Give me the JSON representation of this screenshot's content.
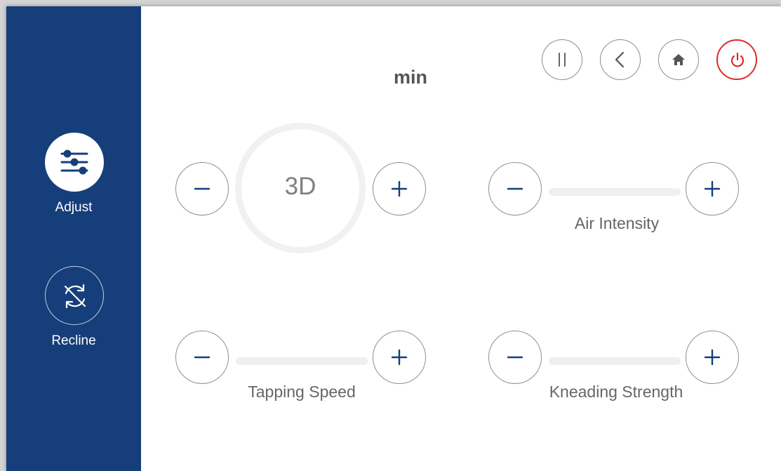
{
  "sidebar": {
    "items": [
      {
        "label": "Adjust",
        "icon": "sliders-icon",
        "active": true
      },
      {
        "label": "Recline",
        "icon": "recline-arrows-icon",
        "active": false
      }
    ]
  },
  "header": {
    "timer_unit": "min",
    "buttons": [
      {
        "name": "pause-button",
        "icon": "pause-icon"
      },
      {
        "name": "back-button",
        "icon": "chevron-left-icon"
      },
      {
        "name": "home-button",
        "icon": "home-icon"
      },
      {
        "name": "power-button",
        "icon": "power-icon"
      }
    ]
  },
  "controls": {
    "mode_3d": {
      "value_label": "3D"
    },
    "air_intensity": {
      "label": "Air Intensity"
    },
    "tapping_speed": {
      "label": "Tapping Speed"
    },
    "kneading_strength": {
      "label": "Kneading Strength"
    }
  },
  "colors": {
    "sidebar_bg": "#153e7a",
    "accent": "#153e7a",
    "power": "#e02828",
    "border": "#8f8f8f",
    "track": "#efefef"
  }
}
